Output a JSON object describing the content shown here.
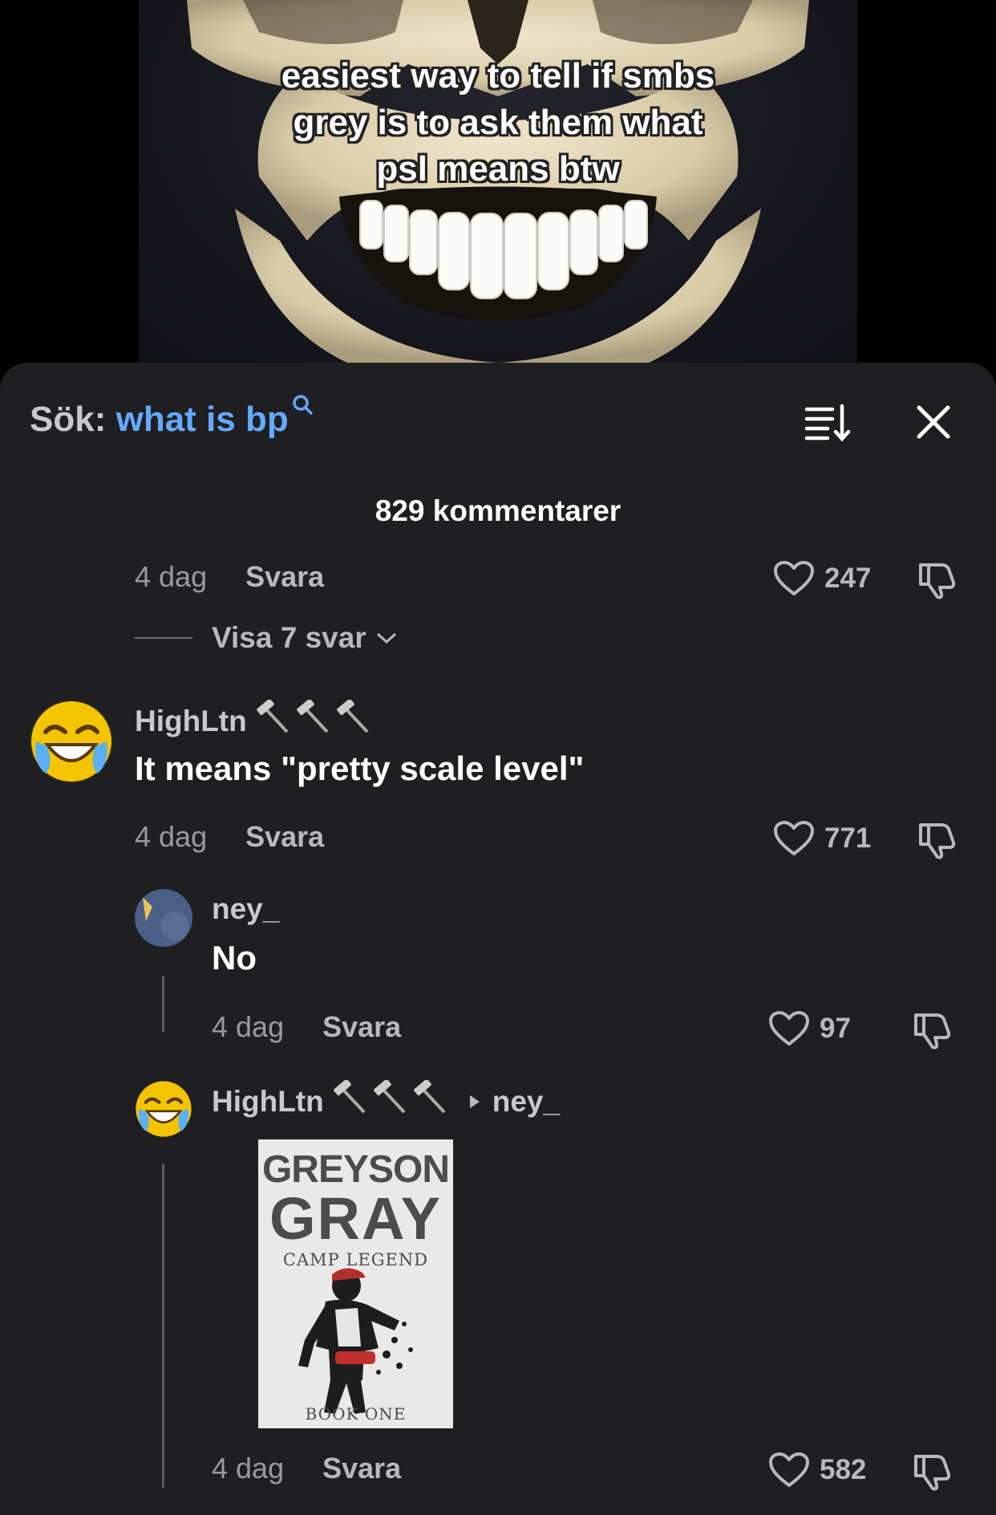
{
  "video": {
    "overlay_lines": [
      "easiest way to tell if smbs",
      "grey is to ask them what",
      "psl means btw"
    ]
  },
  "sheet": {
    "search_prefix": "Sök:",
    "search_term": "what is bp",
    "search_icon": "search-icon",
    "comment_count": "829 kommentarer"
  },
  "comments": [
    {
      "time": "4 dag",
      "reply_label": "Svara",
      "likes": "247"
    },
    {
      "username": "HighLtn",
      "text": "It means \"pretty scale level\"",
      "time": "4 dag",
      "reply_label": "Svara",
      "likes": "771"
    },
    {
      "username": "ney_",
      "text": "No",
      "time": "4 dag",
      "reply_label": "Svara",
      "likes": "97"
    },
    {
      "username": "HighLtn",
      "reply_to": "ney_",
      "time": "4 dag",
      "reply_label": "Svara",
      "likes": "582",
      "image": {
        "title1": "GREYSON",
        "title2": "GRAY",
        "subtitle": "CAMP LEGEND",
        "footer": "BOOK ONE"
      }
    }
  ],
  "view_replies": "Visa 7 svar",
  "colors": {
    "accent": "#64a9ff",
    "sheet_bg": "#1f1f21"
  }
}
